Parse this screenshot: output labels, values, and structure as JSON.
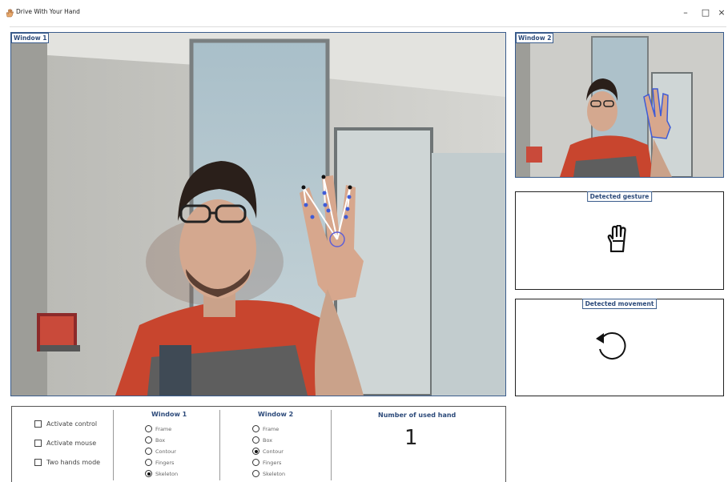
{
  "window": {
    "title": "Drive With Your Hand",
    "controls": [
      "–",
      "□",
      "×"
    ]
  },
  "window1": {
    "label": "Window 1"
  },
  "window2": {
    "label": "Window 2"
  },
  "gesture_box": {
    "label": "Detected gesture",
    "icon": "three-fingers-hand-icon"
  },
  "movement_box": {
    "label": "Detected movement",
    "icon": "rotate-ccw-icon"
  },
  "controls": {
    "checkboxes": [
      {
        "label": "Activate control",
        "checked": false
      },
      {
        "label": "Activate mouse",
        "checked": false
      },
      {
        "label": "Two hands mode",
        "checked": false
      }
    ],
    "window1_col": {
      "title": "Window 1",
      "options": [
        "Frame",
        "Box",
        "Contour",
        "Fingers",
        "Skeleton"
      ],
      "selected": "Skeleton"
    },
    "window2_col": {
      "title": "Window 2",
      "options": [
        "Frame",
        "Box",
        "Contour",
        "Fingers",
        "Skeleton"
      ],
      "selected": "Contour"
    },
    "hands": {
      "title": "Number of used hand",
      "value": "1"
    }
  }
}
